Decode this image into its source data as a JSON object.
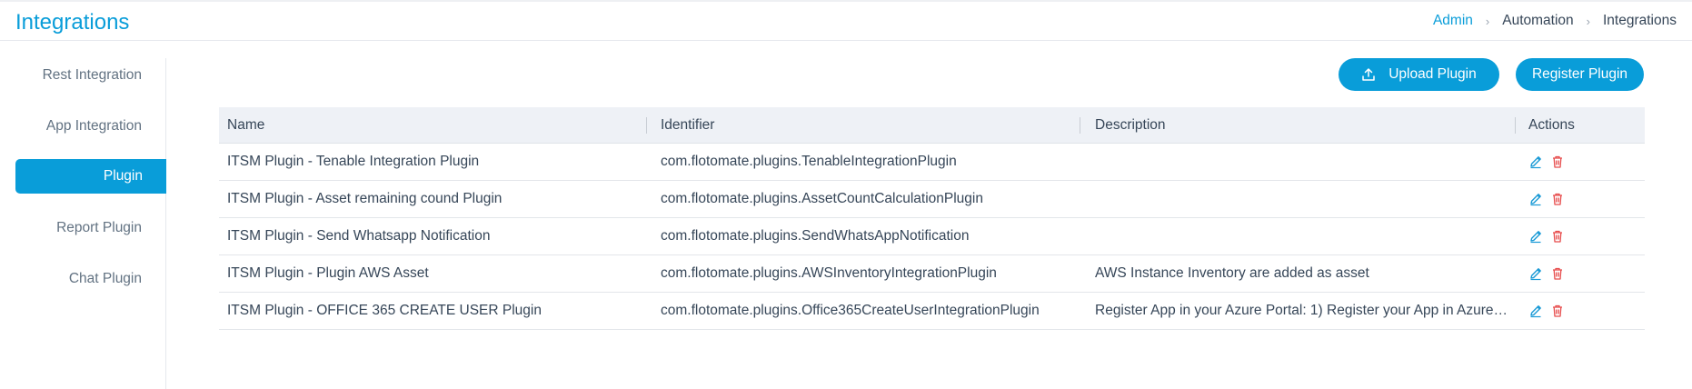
{
  "header": {
    "title": "Integrations",
    "breadcrumb": [
      {
        "label": "Admin"
      },
      {
        "label": "Automation"
      },
      {
        "label": "Integrations"
      }
    ]
  },
  "sidebar": {
    "items": [
      {
        "label": "Rest Integration"
      },
      {
        "label": "App Integration"
      },
      {
        "label": "Plugin",
        "active": true
      },
      {
        "label": "Report Plugin"
      },
      {
        "label": "Chat Plugin"
      }
    ]
  },
  "toolbar": {
    "upload_label": "Upload Plugin",
    "register_label": "Register Plugin"
  },
  "table": {
    "columns": [
      "Name",
      "Identifier",
      "Description",
      "Actions"
    ],
    "rows": [
      {
        "name": "ITSM Plugin - Tenable Integration Plugin",
        "identifier": "com.flotomate.plugins.TenableIntegrationPlugin",
        "description": ""
      },
      {
        "name": "ITSM Plugin - Asset remaining cound Plugin",
        "identifier": "com.flotomate.plugins.AssetCountCalculationPlugin",
        "description": ""
      },
      {
        "name": "ITSM Plugin - Send Whatsapp Notification",
        "identifier": "com.flotomate.plugins.SendWhatsAppNotification",
        "description": ""
      },
      {
        "name": "ITSM Plugin - Plugin AWS Asset",
        "identifier": "com.flotomate.plugins.AWSInventoryIntegrationPlugin",
        "description": "AWS Instance Inventory are added as asset"
      },
      {
        "name": "ITSM Plugin - OFFICE 365 CREATE USER Plugin",
        "identifier": "com.flotomate.plugins.Office365CreateUserIntegrationPlugin",
        "description": "Register App in your Azure Portal: 1) Register your App in Azure ..."
      }
    ]
  },
  "colors": {
    "accent": "#099dd9",
    "edit_icon": "#1a9ad6",
    "delete_icon": "#e74c4c"
  }
}
